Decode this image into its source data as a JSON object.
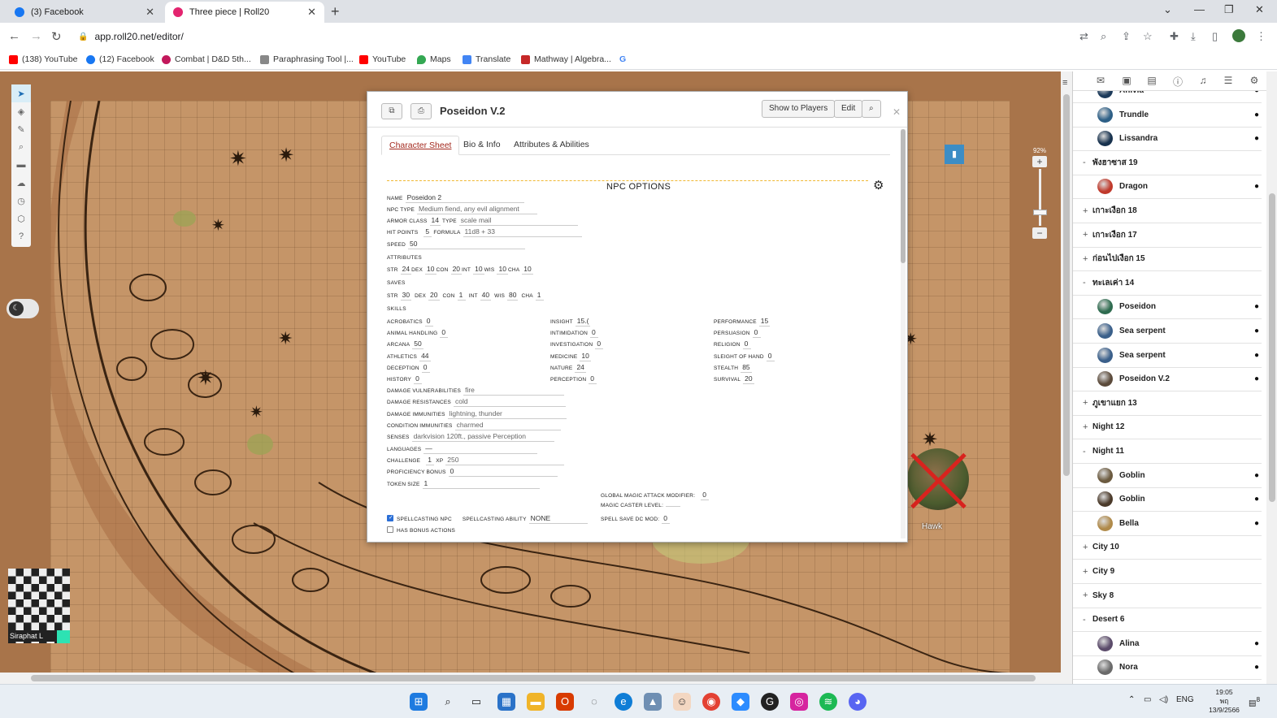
{
  "browser": {
    "tabs": [
      {
        "title": "(3) Facebook",
        "active": false,
        "favicon_color": "#1877f2"
      },
      {
        "title": "Three piece | Roll20",
        "active": true,
        "favicon_color": "#e3246f"
      }
    ],
    "url": "app.roll20.net/editor/",
    "bookmarks": [
      {
        "label": "(138) YouTube",
        "color": "#ff0000"
      },
      {
        "label": "(12) Facebook",
        "color": "#1877f2"
      },
      {
        "label": "Combat | D&D 5th...",
        "color": "#c2185b"
      },
      {
        "label": "Paraphrasing Tool |...",
        "color": "#666666"
      },
      {
        "label": "YouTube",
        "color": "#ff0000"
      },
      {
        "label": "Maps",
        "color": "#34a853"
      },
      {
        "label": "Translate",
        "color": "#4285f4"
      },
      {
        "label": "Mathway | Algebra...",
        "color": "#c62828"
      },
      {
        "label": "G",
        "color": "#4285f4"
      }
    ]
  },
  "roll20": {
    "zoom_label": "92%",
    "player": {
      "name": "Siraphat L",
      "color": "#2de2b3"
    },
    "token_label": "Hawk",
    "dialog": {
      "title": "Poseidon V.2",
      "buttons": {
        "show": "Show to Players",
        "edit": "Edit",
        "search_icon": "search-icon"
      },
      "tabs": [
        "Character Sheet",
        "Bio & Info",
        "Attributes & Abilities"
      ],
      "section_title": "NPC OPTIONS",
      "fields": {
        "name_label": "NAME",
        "name": "Poseidon 2",
        "type_label": "NPC TYPE",
        "type": "Medium fiend, any evil alignment",
        "ac_label": "ARMOR CLASS",
        "ac": "14",
        "actype_label": "TYPE",
        "actype": "scale mail",
        "hp_label": "HIT POINTS",
        "hp": "5",
        "formula_label": "FORMULA",
        "formula": "11d8 + 33",
        "speed_label": "SPEED",
        "speed": "50",
        "attributes_label": "ATTRIBUTES",
        "attributes": [
          {
            "k": "STR",
            "v": "24"
          },
          {
            "k": "DEX",
            "v": "10"
          },
          {
            "k": "CON",
            "v": "20"
          },
          {
            "k": "INT",
            "v": "10"
          },
          {
            "k": "WIS",
            "v": "10"
          },
          {
            "k": "CHA",
            "v": "10"
          }
        ],
        "saves_label": "SAVES",
        "saves": [
          {
            "k": "STR",
            "v": "30"
          },
          {
            "k": "DEX",
            "v": "20"
          },
          {
            "k": "CON",
            "v": "1"
          },
          {
            "k": "INT",
            "v": "40"
          },
          {
            "k": "WIS",
            "v": "80"
          },
          {
            "k": "CHA",
            "v": "1"
          }
        ],
        "skills_label": "SKILLS",
        "skills_col1": [
          {
            "k": "ACROBATICS",
            "v": "0"
          },
          {
            "k": "ANIMAL HANDLING",
            "v": "0"
          },
          {
            "k": "ARCANA",
            "v": "50"
          },
          {
            "k": "ATHLETICS",
            "v": "44"
          },
          {
            "k": "DECEPTION",
            "v": "0"
          },
          {
            "k": "HISTORY",
            "v": "0"
          }
        ],
        "skills_col2": [
          {
            "k": "INSIGHT",
            "v": "15.("
          },
          {
            "k": "INTIMIDATION",
            "v": "0"
          },
          {
            "k": "INVESTIGATION",
            "v": "0"
          },
          {
            "k": "MEDICINE",
            "v": "10"
          },
          {
            "k": "NATURE",
            "v": "24"
          },
          {
            "k": "PERCEPTION",
            "v": "0"
          }
        ],
        "skills_col3": [
          {
            "k": "PERFORMANCE",
            "v": "15"
          },
          {
            "k": "PERSUASION",
            "v": "0"
          },
          {
            "k": "RELIGION",
            "v": "0"
          },
          {
            "k": "SLEIGHT OF HAND",
            "v": "0"
          },
          {
            "k": "STEALTH",
            "v": "85"
          },
          {
            "k": "SURVIVAL",
            "v": "20"
          }
        ],
        "traits": [
          {
            "k": "DAMAGE VULNERABILITIES",
            "v": "fire"
          },
          {
            "k": "DAMAGE RESISTANCES",
            "v": "cold"
          },
          {
            "k": "DAMAGE IMMUNITIES",
            "v": "lightning, thunder"
          },
          {
            "k": "CONDITION IMMUNITIES",
            "v": "charmed"
          },
          {
            "k": "SENSES",
            "v": "darkvision 120ft., passive Perception"
          },
          {
            "k": "LANGUAGES",
            "v": "—"
          }
        ],
        "challenge_label": "CHALLENGE",
        "challenge": "1",
        "xp_label": "XP",
        "xp": "250",
        "prof_label": "PROFICIENCY BONUS",
        "prof": "0",
        "token_label": "TOKEN SIZE",
        "token": "1",
        "magic_mod_label": "GLOBAL MAGIC ATTACK MODIFIER:",
        "magic_mod": "0",
        "caster_label": "MAGIC CASTER LEVEL:",
        "spell_dc_label": "SPELL SAVE DC MOD:",
        "spell_dc": "0",
        "spellcasting_label": "SPELLCASTING NPC",
        "spell_ability_label": "SPELLCASTING ABILITY",
        "spell_ability": "NONE",
        "bonus_actions_label": "HAS BONUS ACTIONS"
      }
    },
    "journal": [
      {
        "kind": "char",
        "name": "Anivia",
        "color": "#1c3a5a"
      },
      {
        "kind": "char",
        "name": "Trundle",
        "color": "#2d5f86"
      },
      {
        "kind": "char",
        "name": "Lissandra",
        "color": "#17314d"
      },
      {
        "kind": "folder",
        "name": "พังฮาซาส 19",
        "open": true
      },
      {
        "kind": "char",
        "name": "Dragon",
        "color": "#c0392b"
      },
      {
        "kind": "folder",
        "name": "เกาะเงือก 18",
        "open": false
      },
      {
        "kind": "folder",
        "name": "เกาะเงือก 17",
        "open": false
      },
      {
        "kind": "folder",
        "name": "ก่อนไปเงือก 15",
        "open": false
      },
      {
        "kind": "folder",
        "name": "ทะเลเค่า 14",
        "open": true
      },
      {
        "kind": "char",
        "name": "Poseidon",
        "color": "#2e6b4f"
      },
      {
        "kind": "char",
        "name": "Sea serpent",
        "color": "#3a5f8a"
      },
      {
        "kind": "char",
        "name": "Sea serpent",
        "color": "#3a5f8a"
      },
      {
        "kind": "char",
        "name": "Poseidon V.2",
        "color": "#5b4a3a"
      },
      {
        "kind": "folder",
        "name": "ภูเขาแยก 13",
        "open": false
      },
      {
        "kind": "folder",
        "name": "Night 12",
        "open": false
      },
      {
        "kind": "folder",
        "name": "Night 11",
        "open": true
      },
      {
        "kind": "char",
        "name": "Goblin",
        "color": "#6b5a3f"
      },
      {
        "kind": "char",
        "name": "Goblin",
        "color": "#4b3a2a"
      },
      {
        "kind": "char",
        "name": "Bella",
        "color": "#b08a4a"
      },
      {
        "kind": "folder",
        "name": "City 10",
        "open": false
      },
      {
        "kind": "folder",
        "name": "City 9",
        "open": false
      },
      {
        "kind": "folder",
        "name": "Sky 8",
        "open": false
      },
      {
        "kind": "folder",
        "name": "Desert 6",
        "open": true
      },
      {
        "kind": "char",
        "name": "Alina",
        "color": "#5b4b6a"
      },
      {
        "kind": "char",
        "name": "Nora",
        "color": "#6a6a6a"
      }
    ]
  },
  "system": {
    "lang": "ENG",
    "time": "19:05",
    "day": "พฤ",
    "date": "13/9/2566",
    "notification_count": "8"
  }
}
